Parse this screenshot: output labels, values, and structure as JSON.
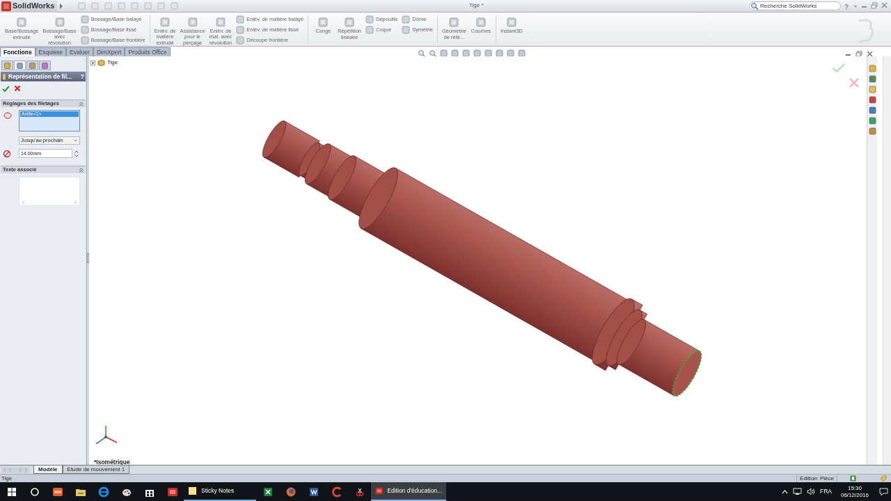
{
  "title_bar": {
    "app_name": "SolidWorks",
    "document_title": "Tige *",
    "search_placeholder": "Recherche SolidWorks",
    "help": "?"
  },
  "ribbon": [
    {
      "kind": "large",
      "label": "Base/Bossage\nextrudé"
    },
    {
      "kind": "large",
      "label": "Bossage/Base\navec\nrévolution"
    },
    {
      "kind": "stack",
      "items": [
        "Bossage/Base balayé",
        "Bossage/Base lissé",
        "Bossage/Base frontière"
      ]
    },
    {
      "kind": "separator"
    },
    {
      "kind": "large",
      "label": "Enlèv. de\nmatière\nextrudé"
    },
    {
      "kind": "large",
      "label": "Assistance\npour le\nperçage"
    },
    {
      "kind": "large",
      "label": "Enlèv. de\nmat. avec\nrévolution"
    },
    {
      "kind": "stack",
      "items": [
        "Enlèv. de matière balayé",
        "Enlèv. de matière lissé",
        "Découpe frontière"
      ]
    },
    {
      "kind": "separator"
    },
    {
      "kind": "large",
      "label": "Congé"
    },
    {
      "kind": "large",
      "label": "Répétition\nlinéaire"
    },
    {
      "kind": "stack",
      "items": [
        "Dépouille",
        "Coque"
      ]
    },
    {
      "kind": "stack",
      "items": [
        "Dôme",
        "Symétrie"
      ]
    },
    {
      "kind": "separator"
    },
    {
      "kind": "large",
      "label": "Géométrie\nde réfé..."
    },
    {
      "kind": "large",
      "label": "Courbes"
    },
    {
      "kind": "separator"
    },
    {
      "kind": "large",
      "label": "Instant3D"
    }
  ],
  "command_tabs": [
    {
      "label": "Fonctions",
      "selected": true
    },
    {
      "label": "Esquisse",
      "selected": false
    },
    {
      "label": "Evaluer",
      "selected": false
    },
    {
      "label": "DimXpert",
      "selected": false
    },
    {
      "label": "Produits Office",
      "selected": false
    }
  ],
  "property_manager": {
    "panel_tabs": [
      {
        "selected": false
      },
      {
        "selected": true
      },
      {
        "selected": false
      },
      {
        "selected": false
      }
    ],
    "title": "Représentation de fil...",
    "help": "?",
    "thread_settings": {
      "title": "Réglages des filetages",
      "edges": [
        {
          "label": "Arête<1>",
          "selected": true
        }
      ],
      "end_condition": "Jusqu'au prochain",
      "diameter": "14.00mm"
    },
    "associated_text": {
      "title": "Texte associé"
    }
  },
  "feature_tree": {
    "root": "Tige"
  },
  "view_orientation": "*Isométrique",
  "bottom_tabs": [
    {
      "label": "Modèle",
      "selected": true
    },
    {
      "label": "Etude de mouvement 1",
      "selected": false
    }
  ],
  "status_bar": {
    "document": "Tige",
    "mode": "Edition: Pièce"
  },
  "taskbar": {
    "apps": [
      {
        "label": "Sticky Notes",
        "selected": false
      },
      {
        "label": "Edition d'éducation...",
        "selected": true
      }
    ],
    "language": "FRA",
    "time": "15:30",
    "date": "06/12/2016"
  }
}
